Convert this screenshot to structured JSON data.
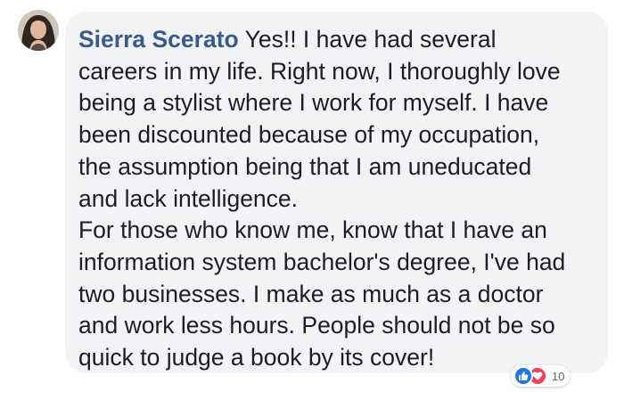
{
  "comment": {
    "author": "Sierra Scerato",
    "body_lines": [
      "Yes!! I have had several",
      "careers in my life. Right now, I thoroughly love",
      "being a stylist where I work for myself. I have",
      "been discounted because of my occupation,",
      "the assumption being that I am uneducated",
      "and lack intelligence.",
      "For those who know me, know that I have an",
      "information system bachelor's degree, I've had",
      "two businesses. I make as much as a doctor",
      "and work less hours. People should not be so",
      "quick to judge a book by its cover!"
    ]
  },
  "reactions": {
    "icons": [
      "like-icon",
      "love-icon"
    ],
    "count": "10"
  },
  "colors": {
    "author_link": "#385898",
    "bubble_bg": "#f2f3f5",
    "text": "#1c1e21",
    "like": "#1877f2",
    "love": "#f33e58"
  }
}
